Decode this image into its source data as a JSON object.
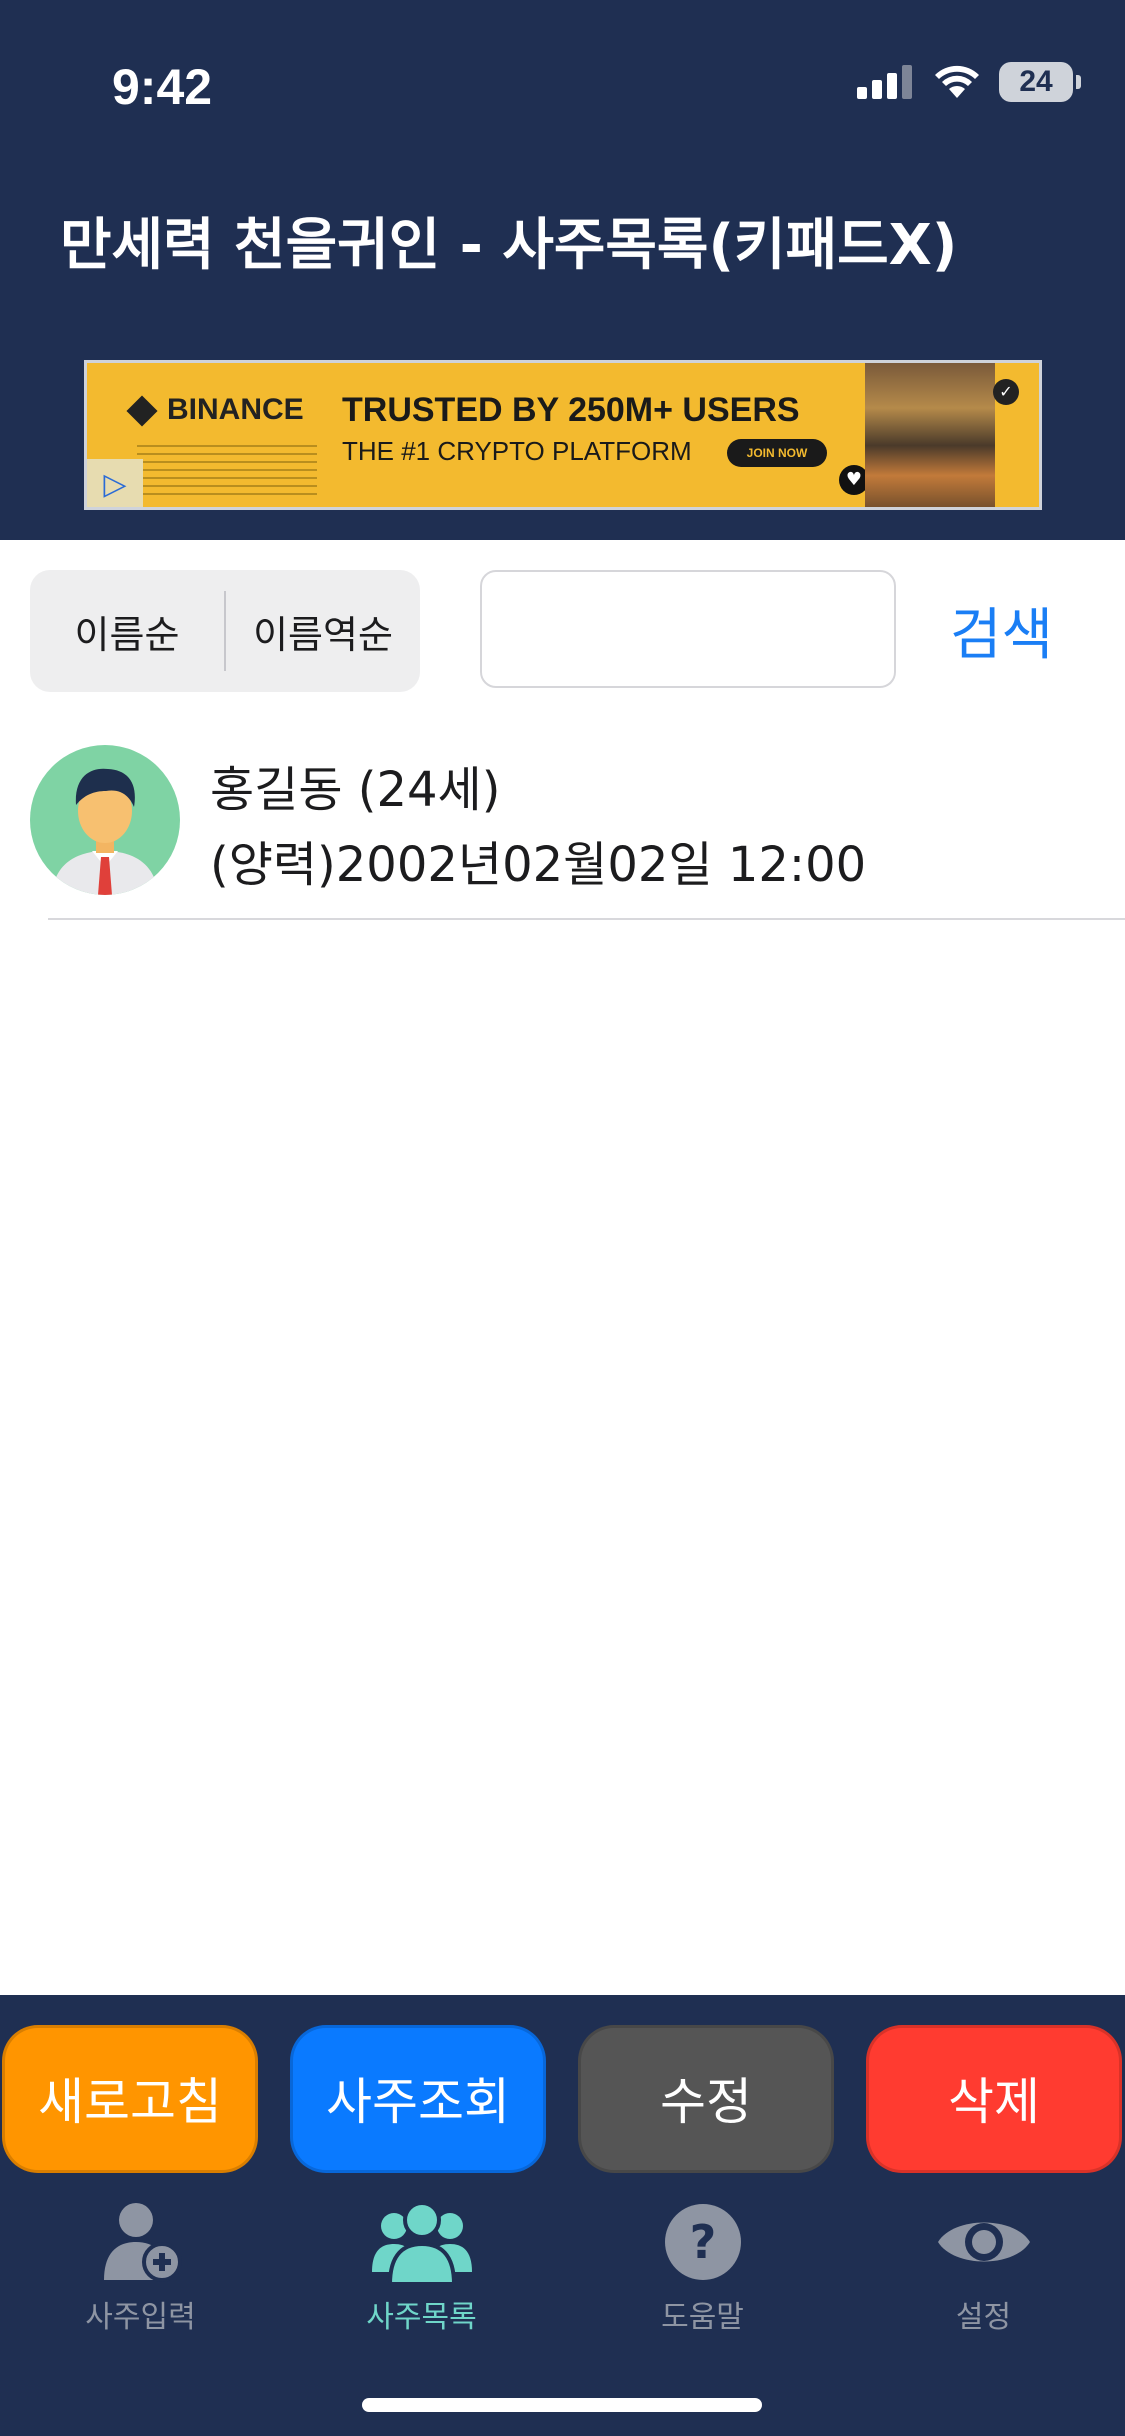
{
  "status": {
    "time": "9:42",
    "battery": "24"
  },
  "app": {
    "title": "만세력 천을귀인 - 사주목록(키패드X)"
  },
  "ad": {
    "brand": "BINANCE",
    "headline": "TRUSTED BY 250M+ USERS",
    "subline": "THE #1 CRYPTO PLATFORM",
    "cta": "JOIN NOW"
  },
  "sort": {
    "options": [
      "이름순",
      "이름역순"
    ]
  },
  "search": {
    "value": "",
    "placeholder": "",
    "button_label": "검색"
  },
  "records": [
    {
      "name": "홍길동 (24세)",
      "birth": "(양력)2002년02월02일 12:00"
    }
  ],
  "actions": {
    "refresh": "새로고침",
    "lookup": "사주조회",
    "edit": "수정",
    "delete": "삭제"
  },
  "tabs": [
    {
      "label": "사주입력",
      "icon": "add-person-icon",
      "active": false
    },
    {
      "label": "사주목록",
      "icon": "people-group-icon",
      "active": true
    },
    {
      "label": "도움말",
      "icon": "help-circle-icon",
      "active": false
    },
    {
      "label": "설정",
      "icon": "eye-icon",
      "active": false
    }
  ],
  "colors": {
    "header_bg": "#1f2f52",
    "accent_blue": "#1a7ef5",
    "refresh": "#ff9500",
    "lookup": "#0a7aff",
    "edit": "#555555",
    "delete": "#ff3b30",
    "tab_active": "#6fd6c9",
    "tab_inactive": "#8e95a3"
  }
}
